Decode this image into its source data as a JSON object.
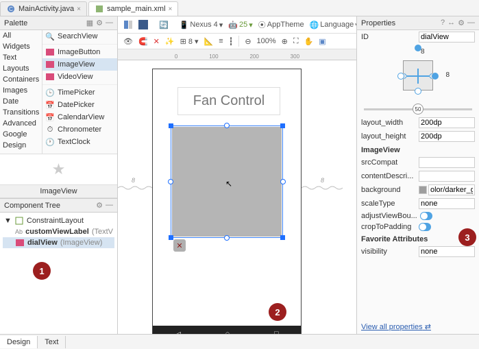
{
  "tabs": {
    "main": "MainActivity.java",
    "layout": "sample_main.xml"
  },
  "palette": {
    "title": "Palette",
    "categories": [
      "All",
      "Widgets",
      "Text",
      "Layouts",
      "Containers",
      "Images",
      "Date",
      "Transitions",
      "Advanced",
      "Google",
      "Design"
    ],
    "widgets": [
      "SearchView",
      "ImageButton",
      "ImageView",
      "VideoView",
      "TimePicker",
      "DatePicker",
      "CalendarView",
      "Chronometer",
      "TextClock"
    ],
    "selected_widget": "ImageView",
    "preview_label": "ImageView"
  },
  "component_tree": {
    "title": "Component Tree",
    "root": "ConstraintLayout",
    "children": [
      {
        "name": "customViewLabel",
        "type": "TextView",
        "display": "customViewLabel (TextV"
      },
      {
        "name": "dialView",
        "type": "ImageView",
        "display": "dialView (ImageView)"
      }
    ]
  },
  "toolbar": {
    "device": "Nexus 4",
    "api": "25",
    "theme": "AppTheme",
    "lang": "Language",
    "zoom": "100%"
  },
  "preview": {
    "label_text": "Fan Control"
  },
  "ruler_marks": [
    "0",
    "100",
    "200",
    "300"
  ],
  "properties": {
    "title": "Properties",
    "id": {
      "label": "ID",
      "value": "dialView"
    },
    "constraints": {
      "top": "8",
      "right": "8"
    },
    "slider_value": "50",
    "layout_width": {
      "label": "layout_width",
      "value": "200dp"
    },
    "layout_height": {
      "label": "layout_height",
      "value": "200dp"
    },
    "section_iv": "ImageView",
    "srcCompat": {
      "label": "srcCompat",
      "value": ""
    },
    "contentDescription": {
      "label": "contentDescri...",
      "value": ""
    },
    "background": {
      "label": "background",
      "value": "olor/darker_gray"
    },
    "scaleType": {
      "label": "scaleType",
      "value": "none"
    },
    "adjustViewBounds": {
      "label": "adjustViewBou..."
    },
    "cropToPadding": {
      "label": "cropToPadding"
    },
    "section_fav": "Favorite Attributes",
    "visibility": {
      "label": "visibility",
      "value": "none"
    },
    "view_all": "View all properties"
  },
  "callouts": {
    "c1": "1",
    "c2": "2",
    "c3": "3"
  },
  "bottom_tabs": {
    "design": "Design",
    "text": "Text"
  }
}
